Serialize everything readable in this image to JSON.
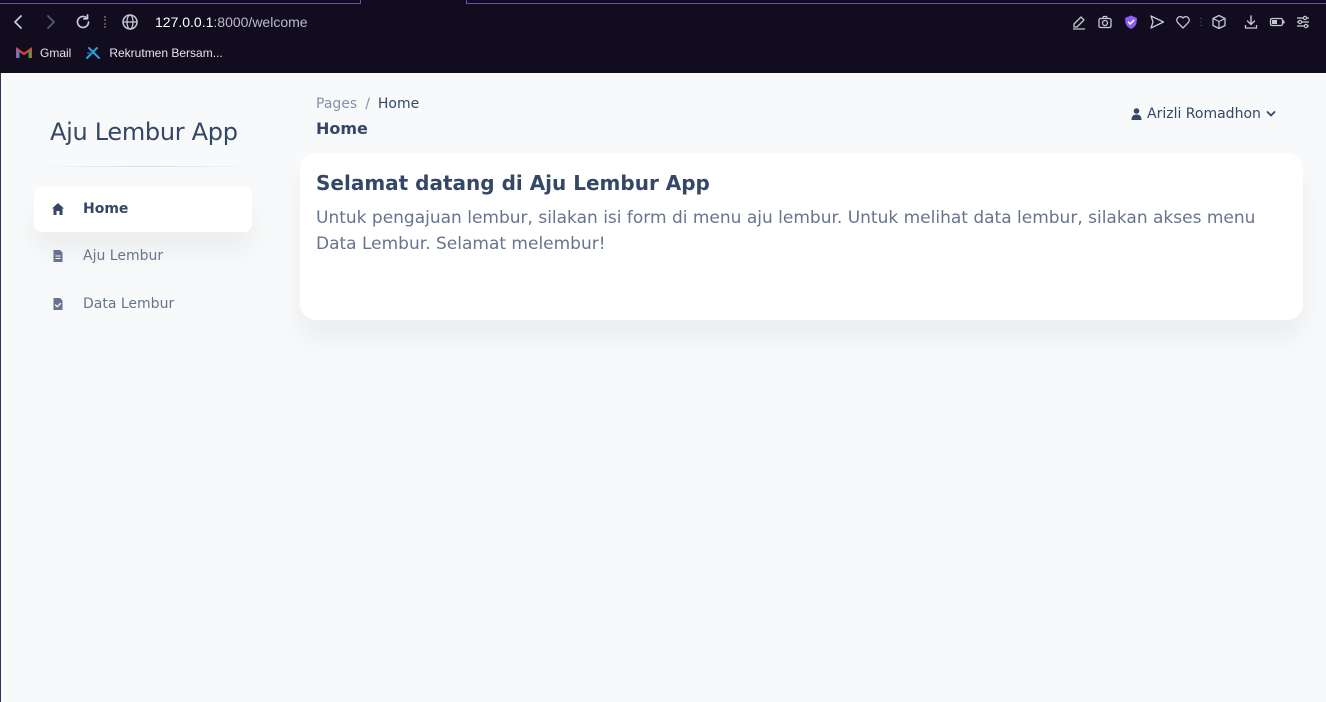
{
  "browser": {
    "url_host": "127.0.0.1",
    "url_rest": ":8000/welcome",
    "bookmarks": [
      {
        "label": "Gmail",
        "icon": "gmail-icon"
      },
      {
        "label": "Rekrutmen Bersam...",
        "icon": "rekrutmen-icon"
      }
    ],
    "accent_color": "#8b5cf6"
  },
  "app": {
    "brand": "Aju Lembur App",
    "sidebar": {
      "items": [
        {
          "label": "Home",
          "icon": "home-icon",
          "active": true
        },
        {
          "label": "Aju Lembur",
          "icon": "document-icon",
          "active": false
        },
        {
          "label": "Data Lembur",
          "icon": "document-check-icon",
          "active": false
        }
      ]
    },
    "breadcrumb": {
      "parent": "Pages",
      "separator": "/",
      "current": "Home"
    },
    "page_title": "Home",
    "user": {
      "name": "Arizli Romadhon"
    },
    "card": {
      "title": "Selamat datang di Aju Lembur App",
      "text": "Untuk pengajuan lembur, silakan isi form di menu aju lembur. Untuk melihat data lembur, silakan akses menu Data Lembur. Selamat melembur!"
    },
    "colors": {
      "heading": "#344767",
      "muted": "#67748e",
      "background": "#f8f9fa"
    }
  }
}
